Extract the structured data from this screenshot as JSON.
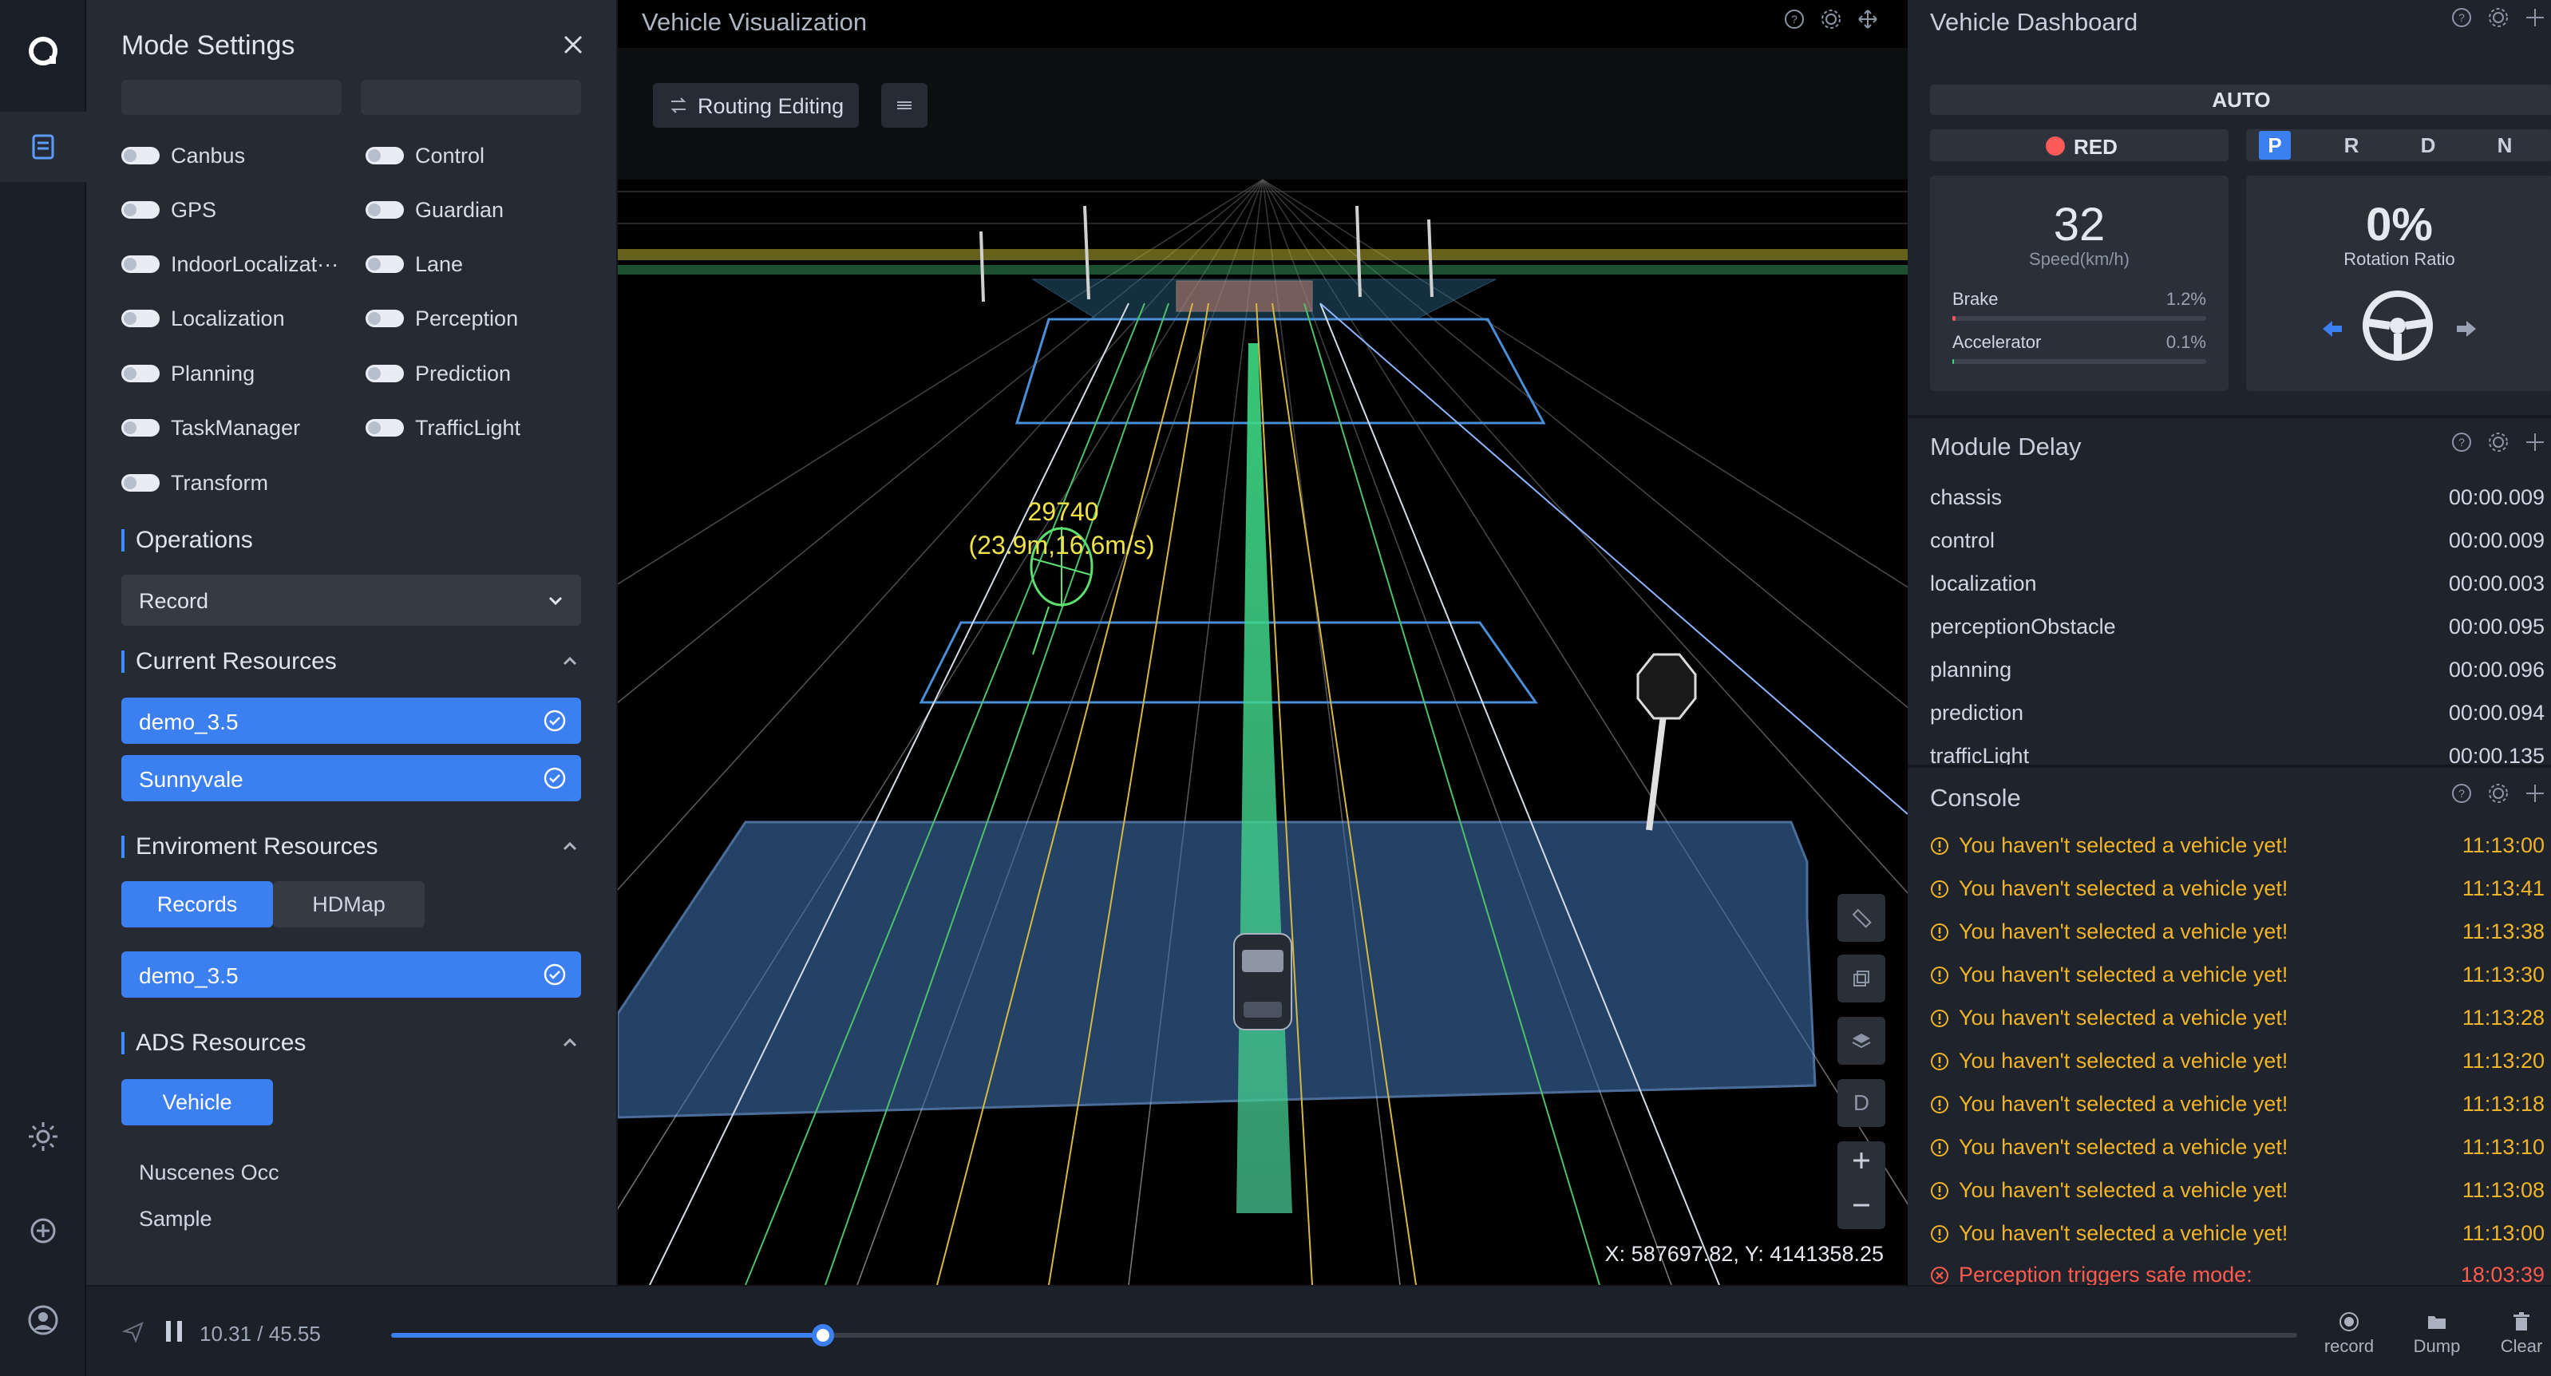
{
  "settings": {
    "title": "Mode Settings",
    "toggles_left": [
      "Canbus",
      "GPS",
      "IndoorLocalizat···",
      "Localization",
      "Planning",
      "TaskManager",
      "Transform"
    ],
    "toggles_right": [
      "Control",
      "Guardian",
      "Lane",
      "Perception",
      "Prediction",
      "TrafficLight"
    ],
    "operations": {
      "title": "Operations",
      "selected": "Record"
    },
    "current_resources": {
      "title": "Current Resources",
      "items": [
        "demo_3.5",
        "Sunnyvale"
      ]
    },
    "environment_resources": {
      "title": "Enviroment Resources",
      "tabs": [
        "Records",
        "HDMap"
      ],
      "active_tab": "Records",
      "items": [
        "demo_3.5"
      ]
    },
    "ads_resources": {
      "title": "ADS Resources",
      "button": "Vehicle",
      "items": [
        "Nuscenes Occ",
        "Sample"
      ]
    }
  },
  "viz": {
    "title": "Vehicle Visualization",
    "routing_button": "Routing Editing",
    "obstacle_id": "29740",
    "obstacle_info": "(23.9m,16.6m/s)",
    "view_mode": "D",
    "coords": "X: 587697.82, Y: 4141358.25"
  },
  "dashboard": {
    "title": "Vehicle Dashboard",
    "mode": "AUTO",
    "signal": "RED",
    "gears": [
      "P",
      "R",
      "D",
      "N"
    ],
    "active_gear": "P",
    "speed": "32",
    "speed_label": "Speed(km/h)",
    "brake": {
      "label": "Brake",
      "value": "1.2%",
      "fraction": 0.012
    },
    "accelerator": {
      "label": "Accelerator",
      "value": "0.1%",
      "fraction": 0.001
    },
    "rotation": "0%",
    "rotation_label": "Rotation Ratio"
  },
  "module_delay": {
    "title": "Module Delay",
    "rows": [
      {
        "name": "chassis",
        "value": "00:00.009"
      },
      {
        "name": "control",
        "value": "00:00.009"
      },
      {
        "name": "localization",
        "value": "00:00.003"
      },
      {
        "name": "perceptionObstacle",
        "value": "00:00.095"
      },
      {
        "name": "planning",
        "value": "00:00.096"
      },
      {
        "name": "prediction",
        "value": "00:00.094"
      },
      {
        "name": "trafficLight",
        "value": "00:00.135"
      }
    ]
  },
  "console": {
    "title": "Console",
    "rows": [
      {
        "msg": "You haven't selected a vehicle yet!",
        "time": "11:13:00",
        "level": "warn"
      },
      {
        "msg": "You haven't selected a vehicle yet!",
        "time": "11:13:41",
        "level": "warn"
      },
      {
        "msg": "You haven't selected a vehicle yet!",
        "time": "11:13:38",
        "level": "warn"
      },
      {
        "msg": "You haven't selected a vehicle yet!",
        "time": "11:13:30",
        "level": "warn"
      },
      {
        "msg": "You haven't selected a vehicle yet!",
        "time": "11:13:28",
        "level": "warn"
      },
      {
        "msg": "You haven't selected a vehicle yet!",
        "time": "11:13:20",
        "level": "warn"
      },
      {
        "msg": "You haven't selected a vehicle yet!",
        "time": "11:13:18",
        "level": "warn"
      },
      {
        "msg": "You haven't selected a vehicle yet!",
        "time": "11:13:10",
        "level": "warn"
      },
      {
        "msg": "You haven't selected a vehicle yet!",
        "time": "11:13:08",
        "level": "warn"
      },
      {
        "msg": "You haven't selected a vehicle yet!",
        "time": "11:13:00",
        "level": "warn"
      },
      {
        "msg": "Perception triggers safe mode:",
        "time": "18:03:39",
        "level": "error"
      }
    ]
  },
  "player": {
    "time": "10.31 / 45.55",
    "progress_fraction": 0.2264,
    "buttons": [
      "record",
      "Dump",
      "Clear"
    ]
  },
  "colors": {
    "accent": "#3b7ff0",
    "warn": "#f0b428",
    "error": "#ff5a4e",
    "route": "#3ddc84"
  }
}
